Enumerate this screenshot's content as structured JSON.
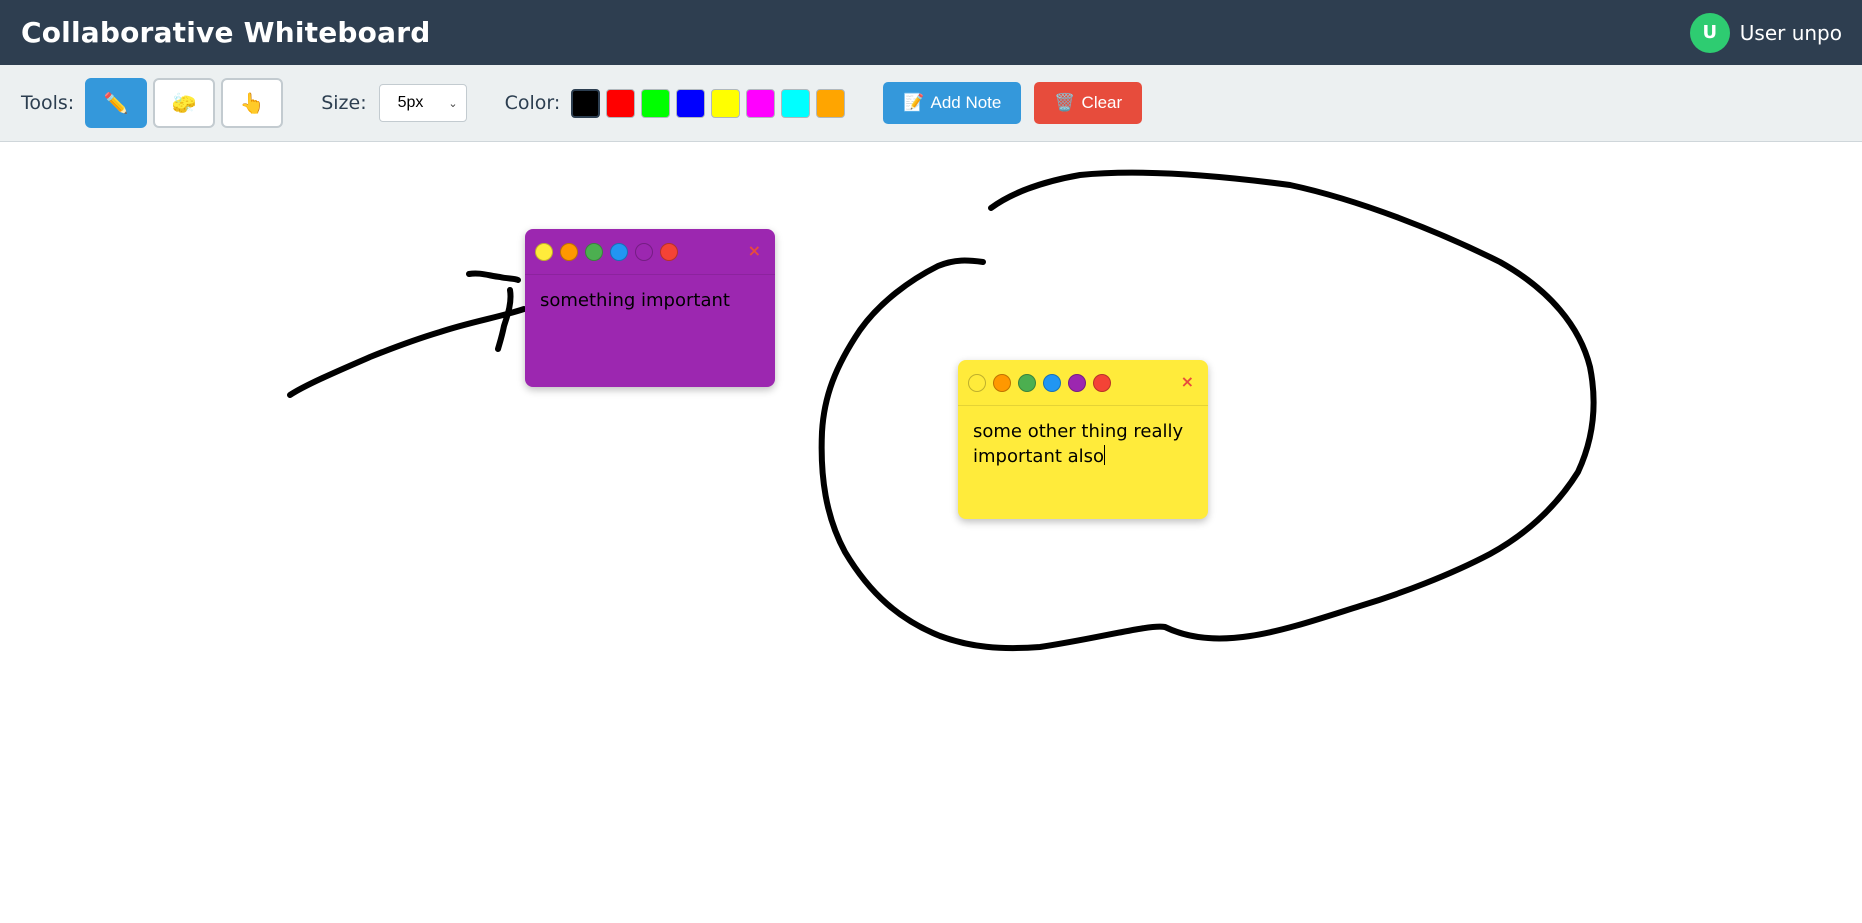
{
  "header": {
    "title": "Collaborative Whiteboard",
    "user": {
      "avatar_initial": "U",
      "name": "User unpo",
      "avatar_color": "#2ecc71"
    }
  },
  "toolbar": {
    "tools_label": "Tools:",
    "tools": [
      {
        "name": "pencil",
        "icon": "✏️",
        "active": true
      },
      {
        "name": "eraser",
        "icon": "🧽",
        "active": false
      },
      {
        "name": "pointer",
        "icon": "👆",
        "active": false
      }
    ],
    "size_label": "Size:",
    "size_value": "5px",
    "color_label": "Color:",
    "colors": [
      "#000000",
      "#ff0000",
      "#00ff00",
      "#0000ff",
      "#ffff00",
      "#ff00ff",
      "#00ffff",
      "#ffa500"
    ],
    "selected_color": "#000000",
    "add_note_icon": "📝",
    "add_note_label": "Add Note",
    "clear_icon": "🗑️",
    "clear_label": "Clear"
  },
  "note_colors": [
    "#ffeb3b",
    "#ff9800",
    "#4caf50",
    "#2196f3",
    "#9c27b0",
    "#f44336"
  ],
  "notes": [
    {
      "color": "#9c27b0",
      "text": "something important",
      "close": "×"
    },
    {
      "color": "#ffeb3b",
      "text_lines": [
        "some other thing really",
        "important also"
      ],
      "close": "×"
    }
  ]
}
